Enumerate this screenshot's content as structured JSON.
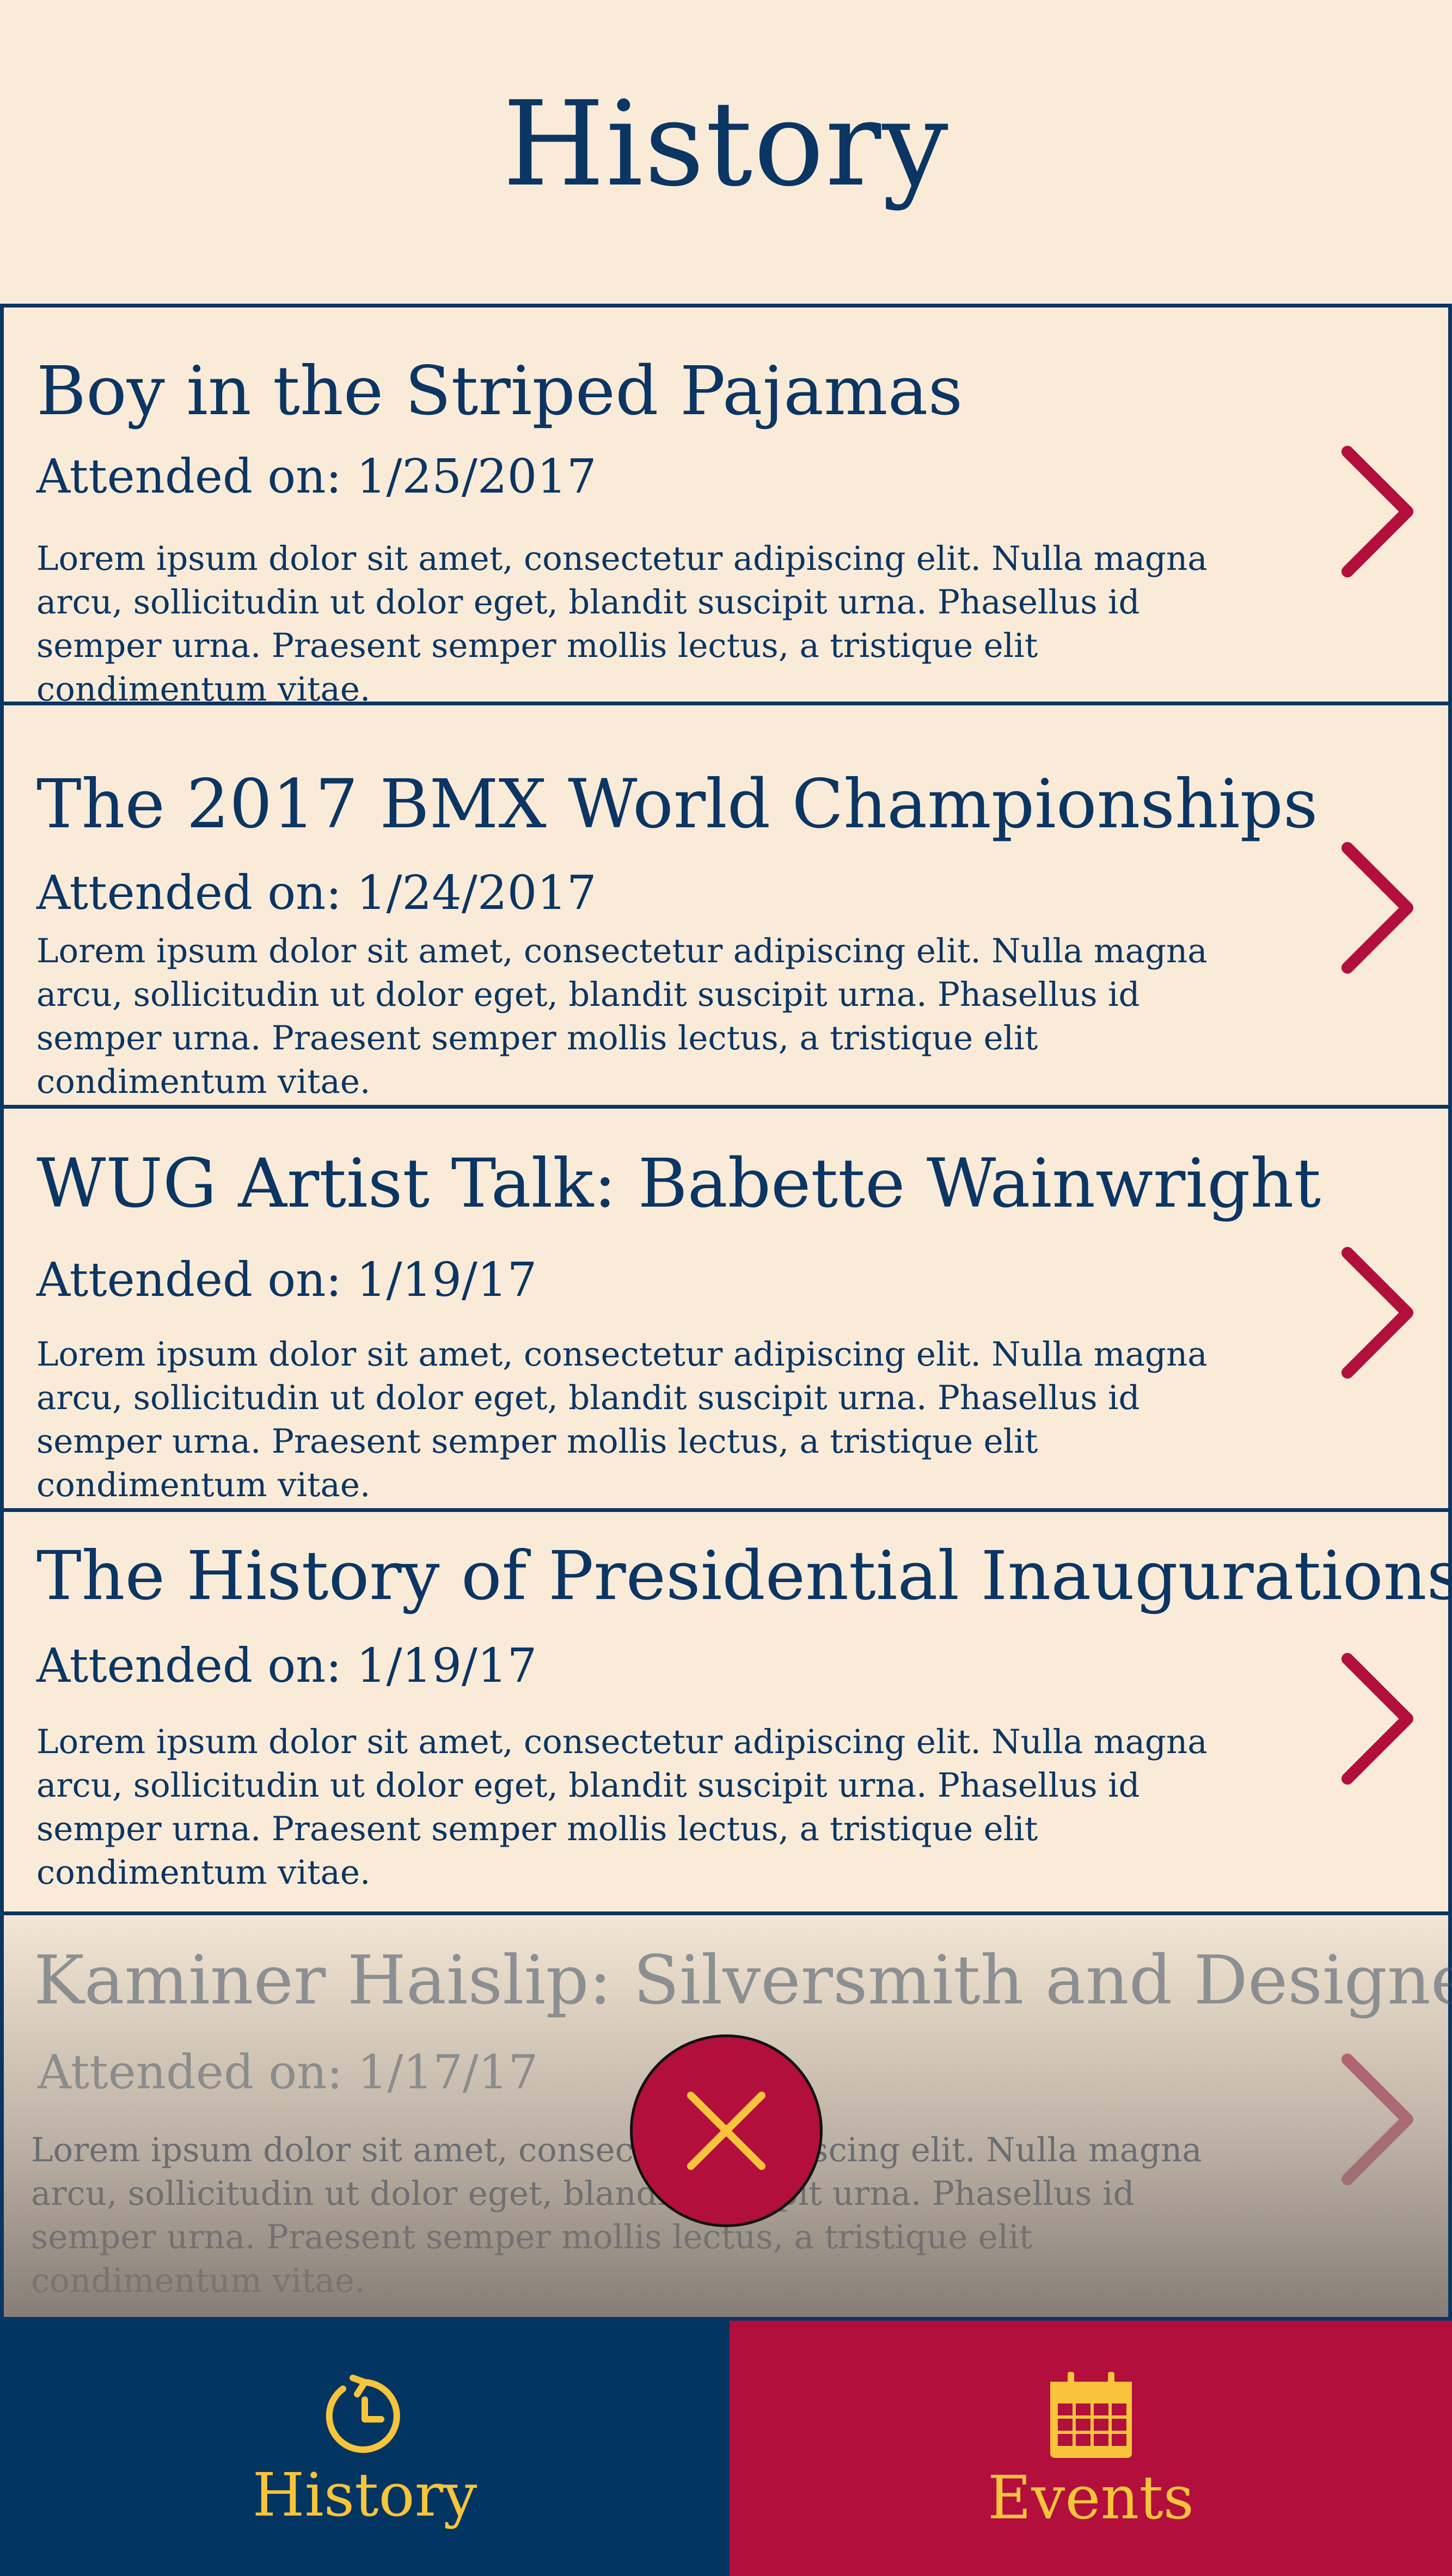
{
  "header": {
    "title": "History"
  },
  "events": [
    {
      "title": "Boy in the Striped Pajamas",
      "date": "Attended on: 1/25/2017",
      "description": "Lorem ipsum dolor sit amet, consectetur adipiscing elit. Nulla magna arcu, sollicitudin ut dolor eget, blandit suscipit urna. Phasellus id semper urna. Praesent semper mollis lectus, a tristique elit condimentum vitae."
    },
    {
      "title": "The 2017 BMX World Championships",
      "date": "Attended on: 1/24/2017",
      "description": "Lorem ipsum dolor sit amet, consectetur adipiscing elit. Nulla magna arcu, sollicitudin ut dolor eget, blandit suscipit urna. Phasellus id semper urna. Praesent semper mollis lectus, a tristique elit condimentum vitae."
    },
    {
      "title": "WUG Artist Talk: Babette Wainwright",
      "date": "Attended on: 1/19/17",
      "description": "Lorem ipsum dolor sit amet, consectetur adipiscing elit. Nulla magna arcu, sollicitudin ut dolor eget, blandit suscipit urna. Phasellus id semper urna. Praesent semper mollis lectus, a tristique elit condimentum vitae."
    },
    {
      "title": "The History of Presidential Inaugurations",
      "date": "Attended on: 1/19/17",
      "description": "Lorem ipsum dolor sit amet, consectetur adipiscing elit. Nulla magna arcu, sollicitudin ut dolor eget, blandit suscipit urna. Phasellus id semper urna. Praesent semper mollis lectus, a tristique elit condimentum vitae."
    },
    {
      "title": "Kaminer Haislip: Silversmith and Designer",
      "date": "Attended on: 1/17/17",
      "description": "Lorem ipsum dolor sit amet, consectetur adipiscing elit. Nulla magna arcu, sollicitudin ut dolor eget, blandit suscipit urna. Phasellus id semper urna. Praesent semper mollis lectus, a tristique elit condimentum vitae."
    }
  ],
  "tabs": {
    "history": {
      "label": "History",
      "icon": "history-clock-icon"
    },
    "events": {
      "label": "Events",
      "icon": "calendar-icon"
    }
  },
  "colors": {
    "background": "#f9ebd8",
    "navy": "#033563",
    "crimson": "#b20f3d",
    "gold": "#f7c43c"
  }
}
